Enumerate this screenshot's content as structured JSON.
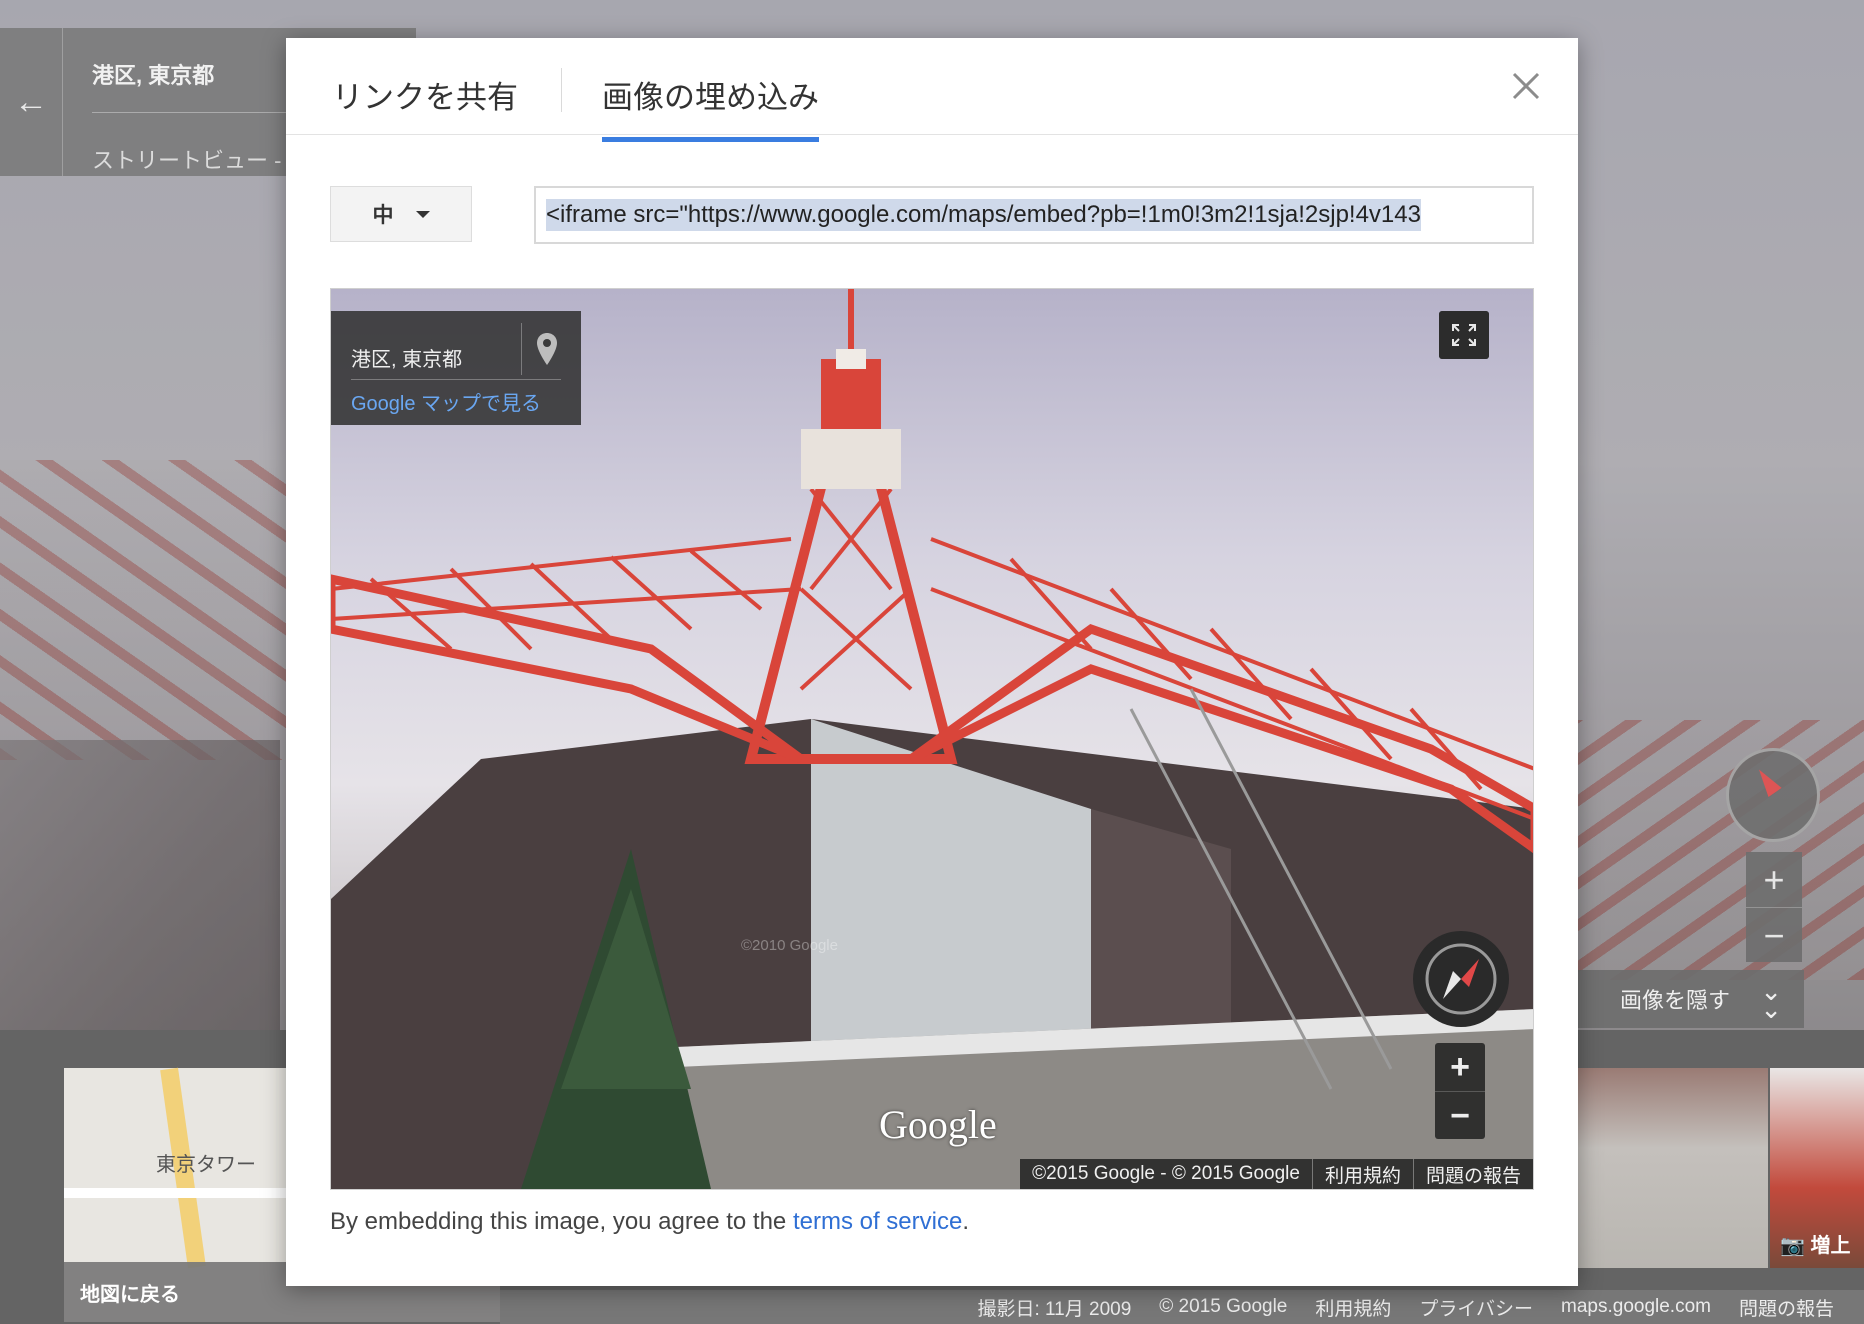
{
  "background": {
    "place_card": {
      "back_icon": "arrow-left-icon",
      "title": "港区, 東京都",
      "subtitle": "ストリートビュー -"
    },
    "hide_images_label": "画像を隠す",
    "map_thumb": {
      "place_label": "東京タワー",
      "back_to_map_label": "地図に戻る"
    },
    "photo_thumb_label": "増上",
    "footer": {
      "items": [
        "撮影日: 11月 2009",
        "© 2015 Google",
        "利用規約",
        "プライバシー",
        "maps.google.com",
        "問題の報告"
      ]
    }
  },
  "dialog": {
    "tabs": [
      {
        "label": "リンクを共有",
        "active": false
      },
      {
        "label": "画像の埋め込み",
        "active": true
      }
    ],
    "close_icon": "close-icon",
    "size_select": {
      "selected": "中"
    },
    "embed_code": "<iframe src=\"https://www.google.com/maps/embed?pb=!1m0!3m2!1sja!2sjp!4v143",
    "preview": {
      "place": "港区, 東京都",
      "maps_link": "Google マップで見る",
      "google_logo": "Google",
      "watermark": "©2010 Google",
      "attribution": [
        "©2015 Google - © 2015 Google",
        "利用規約",
        "問題の報告"
      ]
    },
    "agreement": {
      "prefix": "By embedding this image, you agree to the ",
      "link": "terms of service",
      "suffix": "."
    }
  },
  "colors": {
    "accent": "#3a7de0",
    "link": "#2f6fd4",
    "tower_red": "#d9453a"
  }
}
